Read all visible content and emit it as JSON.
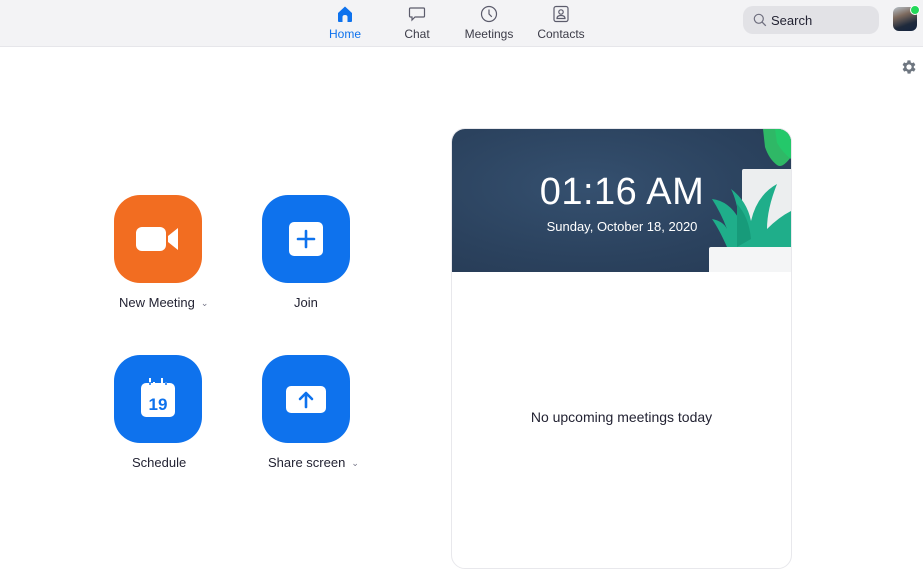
{
  "nav": {
    "tabs": [
      {
        "label": "Home",
        "icon": "home-icon",
        "active": true
      },
      {
        "label": "Chat",
        "icon": "chat-icon",
        "active": false
      },
      {
        "label": "Meetings",
        "icon": "clock-icon",
        "active": false
      },
      {
        "label": "Contacts",
        "icon": "contacts-icon",
        "active": false
      }
    ],
    "search_label": "Search",
    "avatar_status": "online",
    "accent_color": "#0e72ed"
  },
  "actions": [
    {
      "label": "New Meeting",
      "icon": "video-camera-icon",
      "color": "#f26d21",
      "has_dropdown": true
    },
    {
      "label": "Join",
      "icon": "plus-icon",
      "color": "#0e72ed",
      "has_dropdown": false
    },
    {
      "label": "Schedule",
      "icon": "calendar-icon",
      "calendar_day": "19",
      "color": "#0e72ed",
      "has_dropdown": false
    },
    {
      "label": "Share screen",
      "icon": "upload-arrow-icon",
      "color": "#0e72ed",
      "has_dropdown": true
    }
  ],
  "meetings_panel": {
    "time": "01:16 AM",
    "date": "Sunday, October 18, 2020",
    "empty_message": "No upcoming meetings today"
  }
}
